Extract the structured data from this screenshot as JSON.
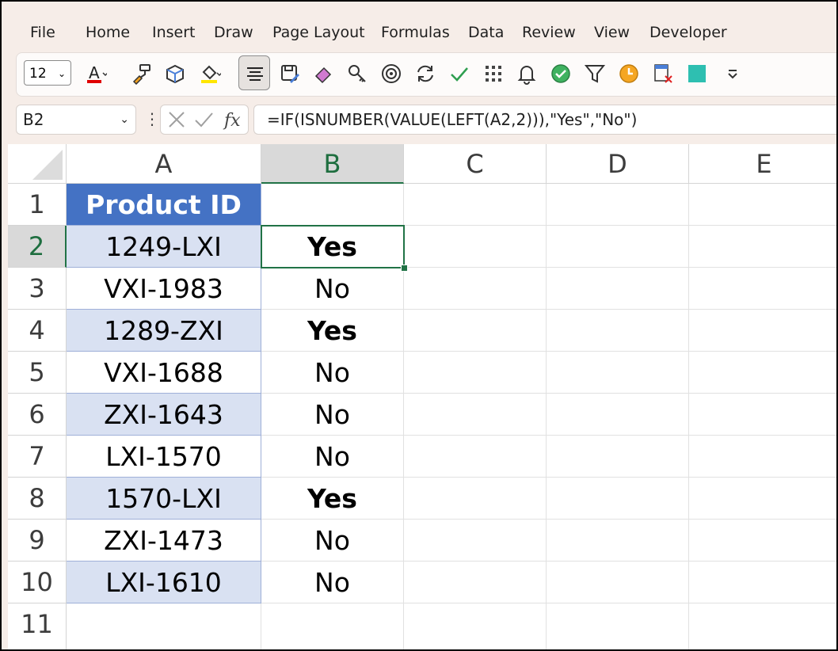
{
  "menu": [
    "File",
    "Home",
    "Insert",
    "Draw",
    "Page Layout",
    "Formulas",
    "Data",
    "Review",
    "View",
    "Developer"
  ],
  "toolbar": {
    "font_size": "12",
    "icons": [
      "font-color-icon",
      "format-painter-icon",
      "3d-box-icon",
      "fill-color-icon",
      "align-center-icon",
      "save-edit-icon",
      "eraser-icon",
      "key-icon",
      "target-icon",
      "refresh-icon",
      "checkmark-icon",
      "grid-dots-icon",
      "bell-icon",
      "check-circle-icon",
      "filter-icon",
      "clock-icon",
      "delete-table-icon",
      "teal-square-icon",
      "more-dropdown-icon"
    ],
    "font_color": "#e00000",
    "fill_color": "#ffe600",
    "teal_color": "#2ebfb1"
  },
  "formula_bar": {
    "name_box": "B2",
    "formula": "=IF(ISNUMBER(VALUE(LEFT(A2,2))),\"Yes\",\"No\")"
  },
  "sheet": {
    "columns": [
      "A",
      "B",
      "C",
      "D",
      "E"
    ],
    "rows": [
      "1",
      "2",
      "3",
      "4",
      "5",
      "6",
      "7",
      "8",
      "9",
      "10",
      "11"
    ],
    "selected_cell": "B2",
    "header_fill": "#4472c4",
    "band_fill": "#d9e1f2",
    "column_a": [
      "Product ID",
      "1249-LXI",
      "VXI-1983",
      "1289-ZXI",
      "VXI-1688",
      "ZXI-1643",
      "LXI-1570",
      "1570-LXI",
      "ZXI-1473",
      "LXI-1610"
    ],
    "column_b": [
      "",
      "Yes",
      "No",
      "Yes",
      "No",
      "No",
      "No",
      "Yes",
      "No",
      "No"
    ]
  }
}
